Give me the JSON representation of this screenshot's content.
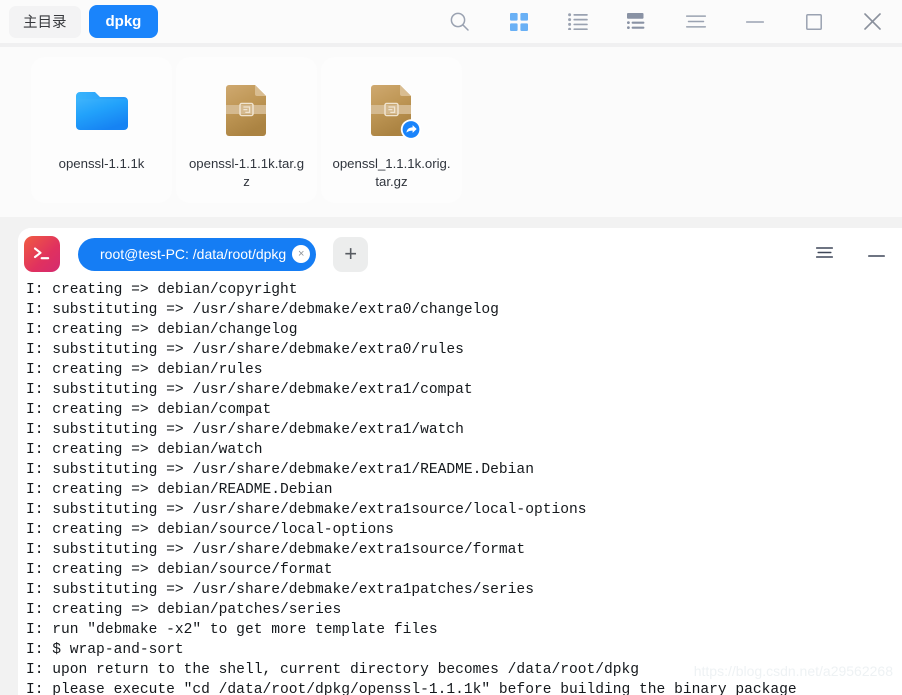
{
  "window": {
    "breadcrumbs": [
      {
        "label": "主目录",
        "active": false
      },
      {
        "label": "dpkg",
        "active": true
      }
    ],
    "toolbar_icons": [
      {
        "name": "search-icon",
        "label": "Search"
      },
      {
        "name": "grid-view-icon",
        "label": "Icon view",
        "active": true
      },
      {
        "name": "list-view-icon",
        "label": "List view"
      },
      {
        "name": "detail-view-icon",
        "label": "Detail view"
      },
      {
        "name": "menu-icon",
        "label": "Menu"
      },
      {
        "name": "minimize-icon",
        "label": "Minimize"
      },
      {
        "name": "maximize-icon",
        "label": "Maximize"
      },
      {
        "name": "close-icon",
        "label": "Close"
      }
    ],
    "accent_color": "#1a84fb",
    "toolbar_icon_color": "#8992a4",
    "active_icon_color": "#69b0f5"
  },
  "files": [
    {
      "name": "openssl-1.1.1k",
      "icon": "folder-icon",
      "type": "folder",
      "symlink": false
    },
    {
      "name": "openssl-1.1.1k.tar.gz",
      "icon": "archive-icon",
      "type": "archive",
      "symlink": false
    },
    {
      "name": "openssl_1.1.1k.orig.tar.gz",
      "icon": "archive-icon",
      "type": "archive",
      "symlink": true
    }
  ],
  "terminal": {
    "logo_name": "terminal-icon",
    "tab": {
      "title": "root@test-PC: /data/root/dpkg",
      "close_glyph": "×"
    },
    "add_tab_glyph": "+",
    "controls": [
      {
        "name": "terminal-menu-icon",
        "label": "Menu"
      },
      {
        "name": "terminal-minimize-icon",
        "label": "Minimize"
      }
    ],
    "output_lines": [
      "I: creating => debian/copyright",
      "I: substituting => /usr/share/debmake/extra0/changelog",
      "I: creating => debian/changelog",
      "I: substituting => /usr/share/debmake/extra0/rules",
      "I: creating => debian/rules",
      "I: substituting => /usr/share/debmake/extra1/compat",
      "I: creating => debian/compat",
      "I: substituting => /usr/share/debmake/extra1/watch",
      "I: creating => debian/watch",
      "I: substituting => /usr/share/debmake/extra1/README.Debian",
      "I: creating => debian/README.Debian",
      "I: substituting => /usr/share/debmake/extra1source/local-options",
      "I: creating => debian/source/local-options",
      "I: substituting => /usr/share/debmake/extra1source/format",
      "I: creating => debian/source/format",
      "I: substituting => /usr/share/debmake/extra1patches/series",
      "I: creating => debian/patches/series",
      "I: run \"debmake -x2\" to get more template files",
      "I: $ wrap-and-sort",
      "I: upon return to the shell, current directory becomes /data/root/dpkg",
      "I: please execute \"cd /data/root/dpkg/openssl-1.1.1k\" before building the binary package"
    ],
    "text_color": "#14181c",
    "background": "#ffffff"
  },
  "watermark": "https://blog.csdn.net/a29562268"
}
